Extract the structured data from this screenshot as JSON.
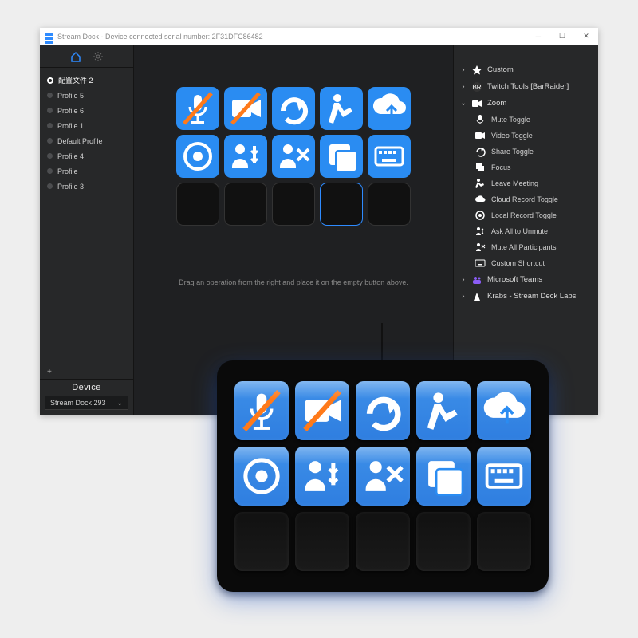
{
  "window": {
    "title": "Stream Dock - Device connected serial number: 2F31DFC86482"
  },
  "sidebar": {
    "profiles": [
      {
        "label": "配置文件 2",
        "selected": true
      },
      {
        "label": "Profile 5",
        "selected": false
      },
      {
        "label": "Profile 6",
        "selected": false
      },
      {
        "label": "Profile 1",
        "selected": false
      },
      {
        "label": "Default Profile",
        "selected": false
      },
      {
        "label": "Profile 4",
        "selected": false
      },
      {
        "label": "Profile",
        "selected": false
      },
      {
        "label": "Profile 3",
        "selected": false
      }
    ],
    "add_label": "+",
    "device_header": "Device",
    "device_selected": "Stream Dock 293"
  },
  "canvas": {
    "hint": "Drag an operation from the right and place it on the empty button above.",
    "keys": [
      {
        "icon": "mute-toggle",
        "filled": true
      },
      {
        "icon": "video-toggle",
        "filled": true
      },
      {
        "icon": "share-toggle",
        "filled": true
      },
      {
        "icon": "leave-meeting",
        "filled": true
      },
      {
        "icon": "cloud-record",
        "filled": true
      },
      {
        "icon": "local-record",
        "filled": true
      },
      {
        "icon": "ask-unmute",
        "filled": true
      },
      {
        "icon": "mute-all",
        "filled": true
      },
      {
        "icon": "focus",
        "filled": true
      },
      {
        "icon": "custom-shortcut",
        "filled": true
      },
      {
        "icon": null,
        "filled": false
      },
      {
        "icon": null,
        "filled": false
      },
      {
        "icon": null,
        "filled": false
      },
      {
        "icon": null,
        "filled": false,
        "selected": true
      },
      {
        "icon": null,
        "filled": false
      }
    ]
  },
  "actions": {
    "groups_top": [
      {
        "label": "Custom",
        "icon": "custom"
      },
      {
        "label": "Twitch Tools [BarRaider]",
        "icon": "twitch"
      }
    ],
    "expanded_group": {
      "label": "Zoom",
      "icon": "zoom"
    },
    "expanded_items": [
      {
        "label": "Mute Toggle",
        "icon": "mute-toggle"
      },
      {
        "label": "Video Toggle",
        "icon": "video-toggle"
      },
      {
        "label": "Share Toggle",
        "icon": "share-toggle"
      },
      {
        "label": "Focus",
        "icon": "focus"
      },
      {
        "label": "Leave Meeting",
        "icon": "leave-meeting"
      },
      {
        "label": "Cloud Record Toggle",
        "icon": "cloud-record"
      },
      {
        "label": "Local Record Toggle",
        "icon": "local-record"
      },
      {
        "label": "Ask All to Unmute",
        "icon": "ask-unmute"
      },
      {
        "label": "Mute All Participants",
        "icon": "mute-all"
      },
      {
        "label": "Custom Shortcut",
        "icon": "custom-shortcut"
      }
    ],
    "groups_bottom": [
      {
        "label": "Microsoft Teams",
        "icon": "teams"
      },
      {
        "label": "Krabs - Stream Deck Labs",
        "icon": "krabs"
      }
    ]
  }
}
